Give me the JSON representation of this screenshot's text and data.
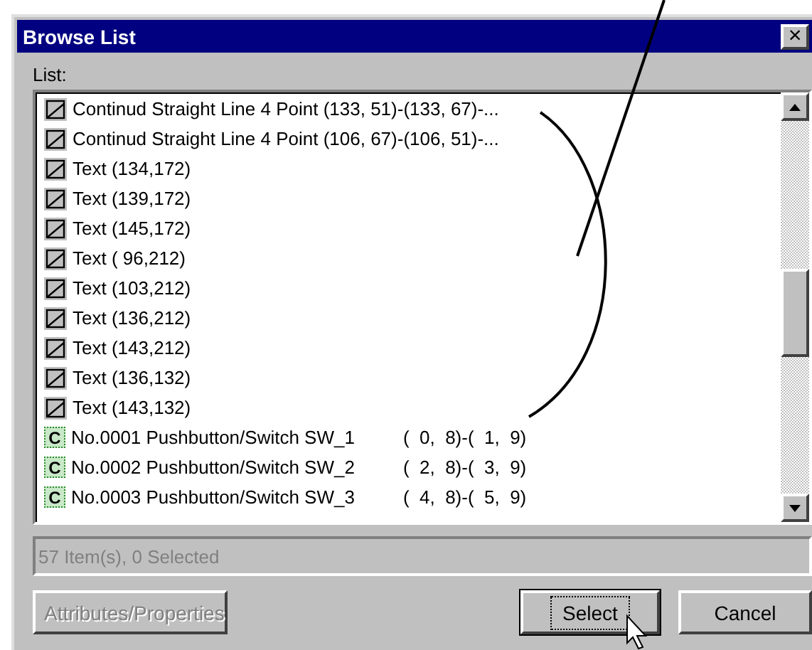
{
  "window": {
    "title": "Browse List",
    "close": "×"
  },
  "list": {
    "label": "List:",
    "items": [
      {
        "kind": "line",
        "text": "Continud Straight Line 4 Point (133, 51)-(133, 67)-...",
        "selected": false
      },
      {
        "kind": "line",
        "text": "Continud Straight Line 4 Point (106, 67)-(106, 51)-...",
        "selected": false
      },
      {
        "kind": "line",
        "text": "Text (134,172)",
        "selected": false
      },
      {
        "kind": "line",
        "text": "Text (139,172)",
        "selected": false
      },
      {
        "kind": "line",
        "text": "Text (145,172)",
        "selected": false
      },
      {
        "kind": "line",
        "text": "Text ( 96,212)",
        "selected": false
      },
      {
        "kind": "line",
        "text": "Text (103,212)",
        "selected": false
      },
      {
        "kind": "line",
        "text": "Text (136,212)",
        "selected": false
      },
      {
        "kind": "line",
        "text": "Text (143,212)",
        "selected": false
      },
      {
        "kind": "line",
        "text": "Text (136,132)",
        "selected": false
      },
      {
        "kind": "line",
        "text": "Text (143,132)",
        "selected": false
      },
      {
        "kind": "component",
        "icon": "C",
        "text": "No.0001 Pushbutton/Switch SW_1",
        "coords": "(  0,  8)-(  1,  9)",
        "selected": false
      },
      {
        "kind": "component",
        "icon": "C",
        "text": "No.0002 Pushbutton/Switch SW_2",
        "coords": "(  2,  8)-(  3,  9)",
        "selected": false
      },
      {
        "kind": "component",
        "icon": "C",
        "text": "No.0003 Pushbutton/Switch SW_3",
        "coords": "(  4,  8)-(  5,  9)",
        "selected": false
      }
    ]
  },
  "status": {
    "value": "57 Item(s), 0 Selected",
    "disabled": true
  },
  "buttons": [
    {
      "label": "Attributes/Properties",
      "disabled": true,
      "default": false
    },
    {
      "label": "Select",
      "disabled": false,
      "default": true
    },
    {
      "label": "Cancel",
      "disabled": false,
      "default": false
    }
  ]
}
